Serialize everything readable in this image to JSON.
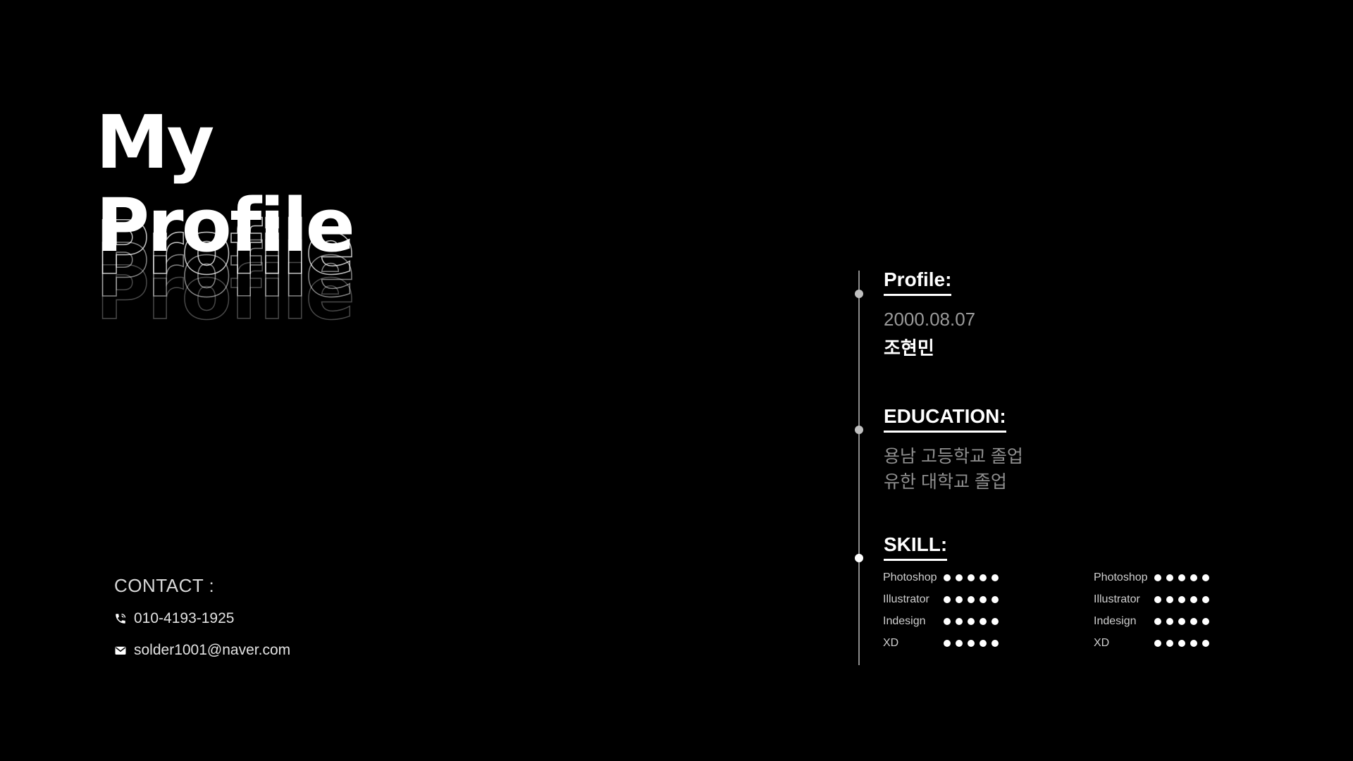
{
  "title": {
    "line1": "My",
    "line2": "Profile"
  },
  "contact": {
    "heading": "CONTACT :",
    "phone_icon": "phone-icon",
    "phone": "010-4193-1925",
    "email_icon": "mail-icon",
    "email": "solder1001@naver.com"
  },
  "profile": {
    "title": "Profile:",
    "birth": "2000.08.07",
    "name": "조현민"
  },
  "education": {
    "title": "EDUCATION:",
    "items": [
      "용남 고등학교 졸업",
      "유한 대학교 졸업"
    ]
  },
  "skill": {
    "title": "SKILL:",
    "columns": [
      [
        {
          "name": "Photoshop",
          "level": 5
        },
        {
          "name": "Illustrator",
          "level": 5
        },
        {
          "name": "Indesign",
          "level": 5
        },
        {
          "name": "XD",
          "level": 5
        }
      ],
      [
        {
          "name": "Photoshop",
          "level": 5
        },
        {
          "name": "Illustrator",
          "level": 5
        },
        {
          "name": "Indesign",
          "level": 5
        },
        {
          "name": "XD",
          "level": 5
        }
      ]
    ]
  },
  "colors": {
    "background": "#000000",
    "text": "#ffffff",
    "muted": "#9a9a9a",
    "timeline": "#8c8c8c"
  }
}
